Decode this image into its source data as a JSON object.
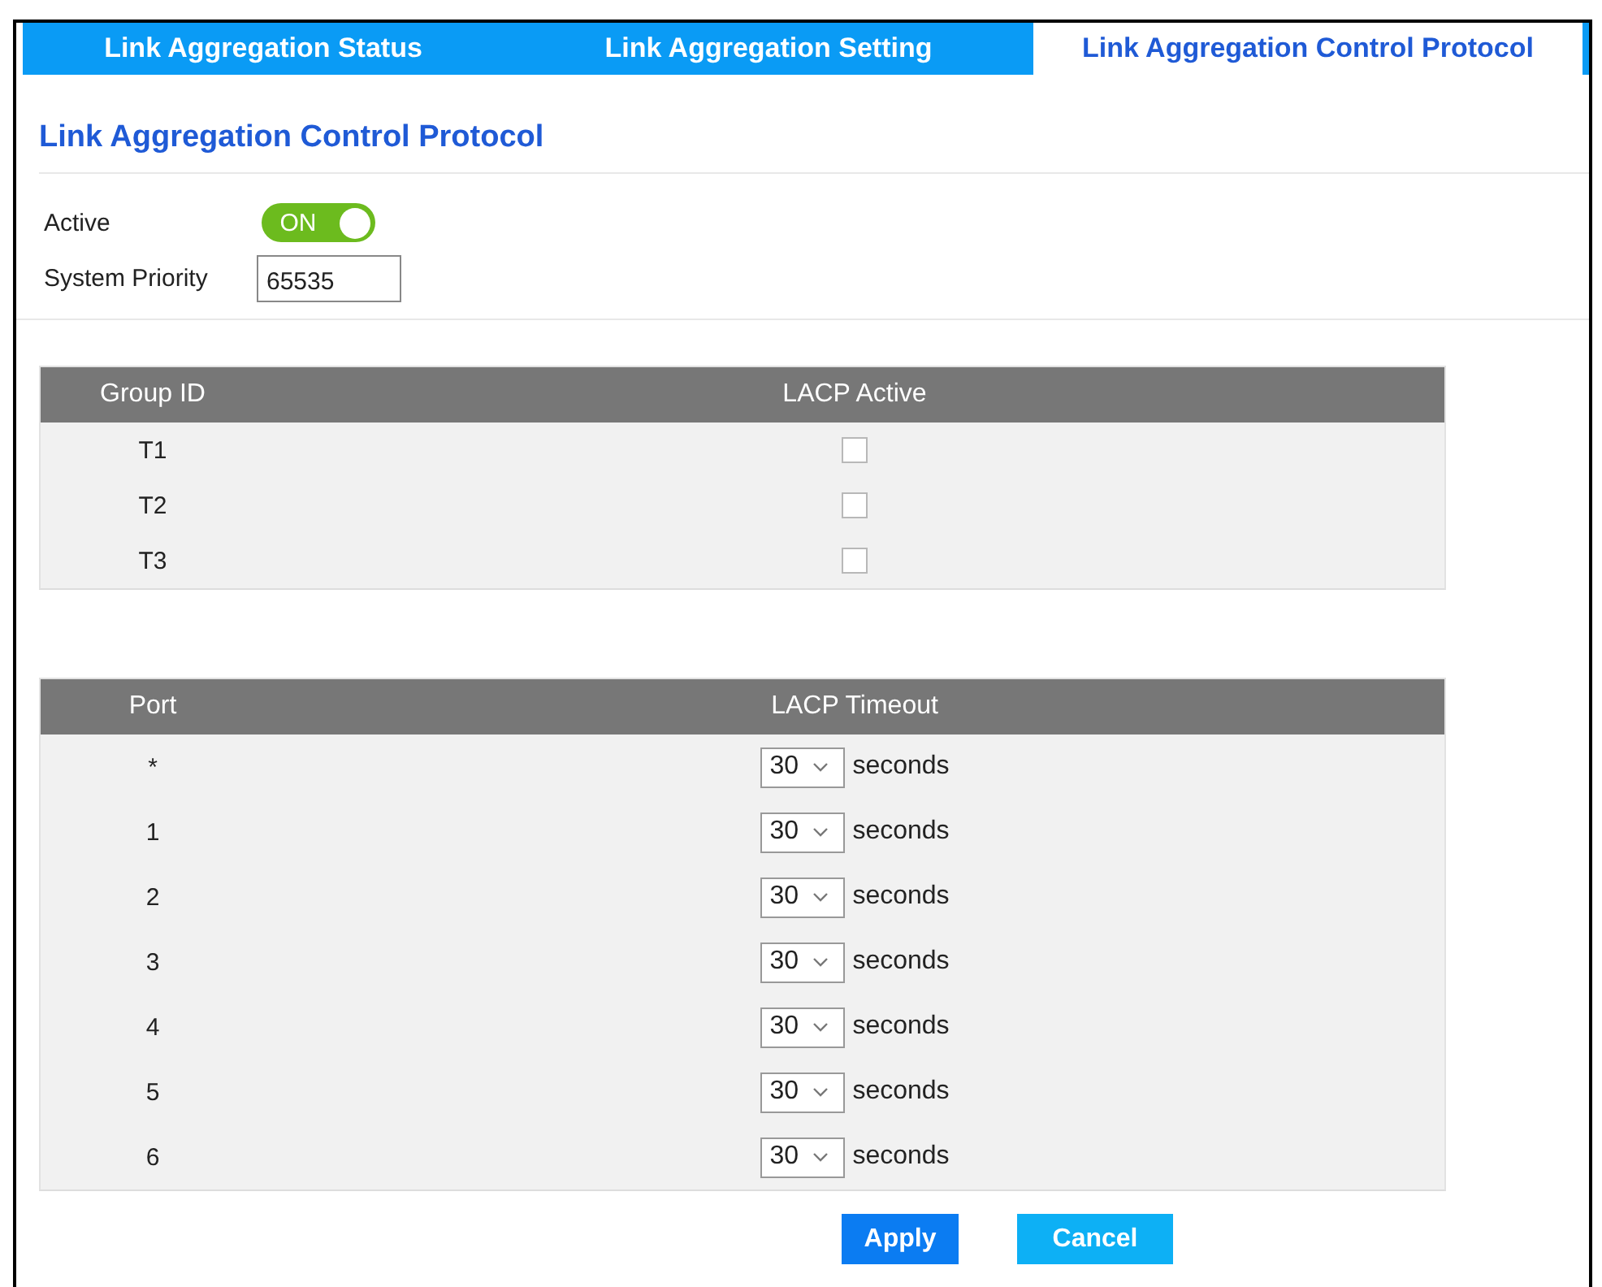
{
  "tabs": [
    {
      "label": "Link Aggregation Status",
      "selected": false
    },
    {
      "label": "Link Aggregation Setting",
      "selected": false
    },
    {
      "label": "Link Aggregation Control Protocol",
      "selected": true
    }
  ],
  "section_title": "Link Aggregation Control Protocol",
  "active": {
    "label": "Active",
    "on": true,
    "text": "ON"
  },
  "system_priority": {
    "label": "System Priority",
    "value": "65535"
  },
  "group_table": {
    "columns": [
      "Group ID",
      "LACP Active"
    ],
    "rows": [
      {
        "group_id": "T1",
        "lacp_active": false
      },
      {
        "group_id": "T2",
        "lacp_active": false
      },
      {
        "group_id": "T3",
        "lacp_active": false
      }
    ]
  },
  "port_table": {
    "columns": [
      "Port",
      "LACP Timeout"
    ],
    "rows": [
      {
        "port": "*",
        "timeout": "30",
        "unit": "seconds"
      },
      {
        "port": "1",
        "timeout": "30",
        "unit": "seconds"
      },
      {
        "port": "2",
        "timeout": "30",
        "unit": "seconds"
      },
      {
        "port": "3",
        "timeout": "30",
        "unit": "seconds"
      },
      {
        "port": "4",
        "timeout": "30",
        "unit": "seconds"
      },
      {
        "port": "5",
        "timeout": "30",
        "unit": "seconds"
      },
      {
        "port": "6",
        "timeout": "30",
        "unit": "seconds"
      }
    ]
  },
  "buttons": [
    {
      "label": "Apply",
      "kind": "primary"
    },
    {
      "label": "Cancel",
      "kind": "secondary"
    }
  ]
}
